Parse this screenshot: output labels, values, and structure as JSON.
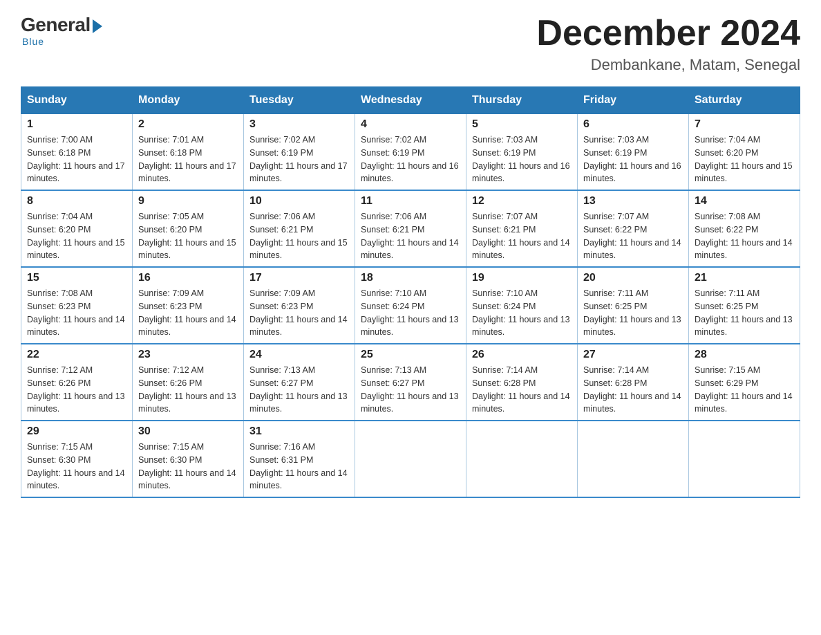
{
  "logo": {
    "general": "General",
    "blue": "Blue",
    "tagline": "Blue"
  },
  "title": {
    "month": "December 2024",
    "location": "Dembankane, Matam, Senegal"
  },
  "headers": [
    "Sunday",
    "Monday",
    "Tuesday",
    "Wednesday",
    "Thursday",
    "Friday",
    "Saturday"
  ],
  "weeks": [
    [
      {
        "day": "1",
        "sunrise": "7:00 AM",
        "sunset": "6:18 PM",
        "daylight": "11 hours and 17 minutes."
      },
      {
        "day": "2",
        "sunrise": "7:01 AM",
        "sunset": "6:18 PM",
        "daylight": "11 hours and 17 minutes."
      },
      {
        "day": "3",
        "sunrise": "7:02 AM",
        "sunset": "6:19 PM",
        "daylight": "11 hours and 17 minutes."
      },
      {
        "day": "4",
        "sunrise": "7:02 AM",
        "sunset": "6:19 PM",
        "daylight": "11 hours and 16 minutes."
      },
      {
        "day": "5",
        "sunrise": "7:03 AM",
        "sunset": "6:19 PM",
        "daylight": "11 hours and 16 minutes."
      },
      {
        "day": "6",
        "sunrise": "7:03 AM",
        "sunset": "6:19 PM",
        "daylight": "11 hours and 16 minutes."
      },
      {
        "day": "7",
        "sunrise": "7:04 AM",
        "sunset": "6:20 PM",
        "daylight": "11 hours and 15 minutes."
      }
    ],
    [
      {
        "day": "8",
        "sunrise": "7:04 AM",
        "sunset": "6:20 PM",
        "daylight": "11 hours and 15 minutes."
      },
      {
        "day": "9",
        "sunrise": "7:05 AM",
        "sunset": "6:20 PM",
        "daylight": "11 hours and 15 minutes."
      },
      {
        "day": "10",
        "sunrise": "7:06 AM",
        "sunset": "6:21 PM",
        "daylight": "11 hours and 15 minutes."
      },
      {
        "day": "11",
        "sunrise": "7:06 AM",
        "sunset": "6:21 PM",
        "daylight": "11 hours and 14 minutes."
      },
      {
        "day": "12",
        "sunrise": "7:07 AM",
        "sunset": "6:21 PM",
        "daylight": "11 hours and 14 minutes."
      },
      {
        "day": "13",
        "sunrise": "7:07 AM",
        "sunset": "6:22 PM",
        "daylight": "11 hours and 14 minutes."
      },
      {
        "day": "14",
        "sunrise": "7:08 AM",
        "sunset": "6:22 PM",
        "daylight": "11 hours and 14 minutes."
      }
    ],
    [
      {
        "day": "15",
        "sunrise": "7:08 AM",
        "sunset": "6:23 PM",
        "daylight": "11 hours and 14 minutes."
      },
      {
        "day": "16",
        "sunrise": "7:09 AM",
        "sunset": "6:23 PM",
        "daylight": "11 hours and 14 minutes."
      },
      {
        "day": "17",
        "sunrise": "7:09 AM",
        "sunset": "6:23 PM",
        "daylight": "11 hours and 14 minutes."
      },
      {
        "day": "18",
        "sunrise": "7:10 AM",
        "sunset": "6:24 PM",
        "daylight": "11 hours and 13 minutes."
      },
      {
        "day": "19",
        "sunrise": "7:10 AM",
        "sunset": "6:24 PM",
        "daylight": "11 hours and 13 minutes."
      },
      {
        "day": "20",
        "sunrise": "7:11 AM",
        "sunset": "6:25 PM",
        "daylight": "11 hours and 13 minutes."
      },
      {
        "day": "21",
        "sunrise": "7:11 AM",
        "sunset": "6:25 PM",
        "daylight": "11 hours and 13 minutes."
      }
    ],
    [
      {
        "day": "22",
        "sunrise": "7:12 AM",
        "sunset": "6:26 PM",
        "daylight": "11 hours and 13 minutes."
      },
      {
        "day": "23",
        "sunrise": "7:12 AM",
        "sunset": "6:26 PM",
        "daylight": "11 hours and 13 minutes."
      },
      {
        "day": "24",
        "sunrise": "7:13 AM",
        "sunset": "6:27 PM",
        "daylight": "11 hours and 13 minutes."
      },
      {
        "day": "25",
        "sunrise": "7:13 AM",
        "sunset": "6:27 PM",
        "daylight": "11 hours and 13 minutes."
      },
      {
        "day": "26",
        "sunrise": "7:14 AM",
        "sunset": "6:28 PM",
        "daylight": "11 hours and 14 minutes."
      },
      {
        "day": "27",
        "sunrise": "7:14 AM",
        "sunset": "6:28 PM",
        "daylight": "11 hours and 14 minutes."
      },
      {
        "day": "28",
        "sunrise": "7:15 AM",
        "sunset": "6:29 PM",
        "daylight": "11 hours and 14 minutes."
      }
    ],
    [
      {
        "day": "29",
        "sunrise": "7:15 AM",
        "sunset": "6:30 PM",
        "daylight": "11 hours and 14 minutes."
      },
      {
        "day": "30",
        "sunrise": "7:15 AM",
        "sunset": "6:30 PM",
        "daylight": "11 hours and 14 minutes."
      },
      {
        "day": "31",
        "sunrise": "7:16 AM",
        "sunset": "6:31 PM",
        "daylight": "11 hours and 14 minutes."
      },
      null,
      null,
      null,
      null
    ]
  ]
}
